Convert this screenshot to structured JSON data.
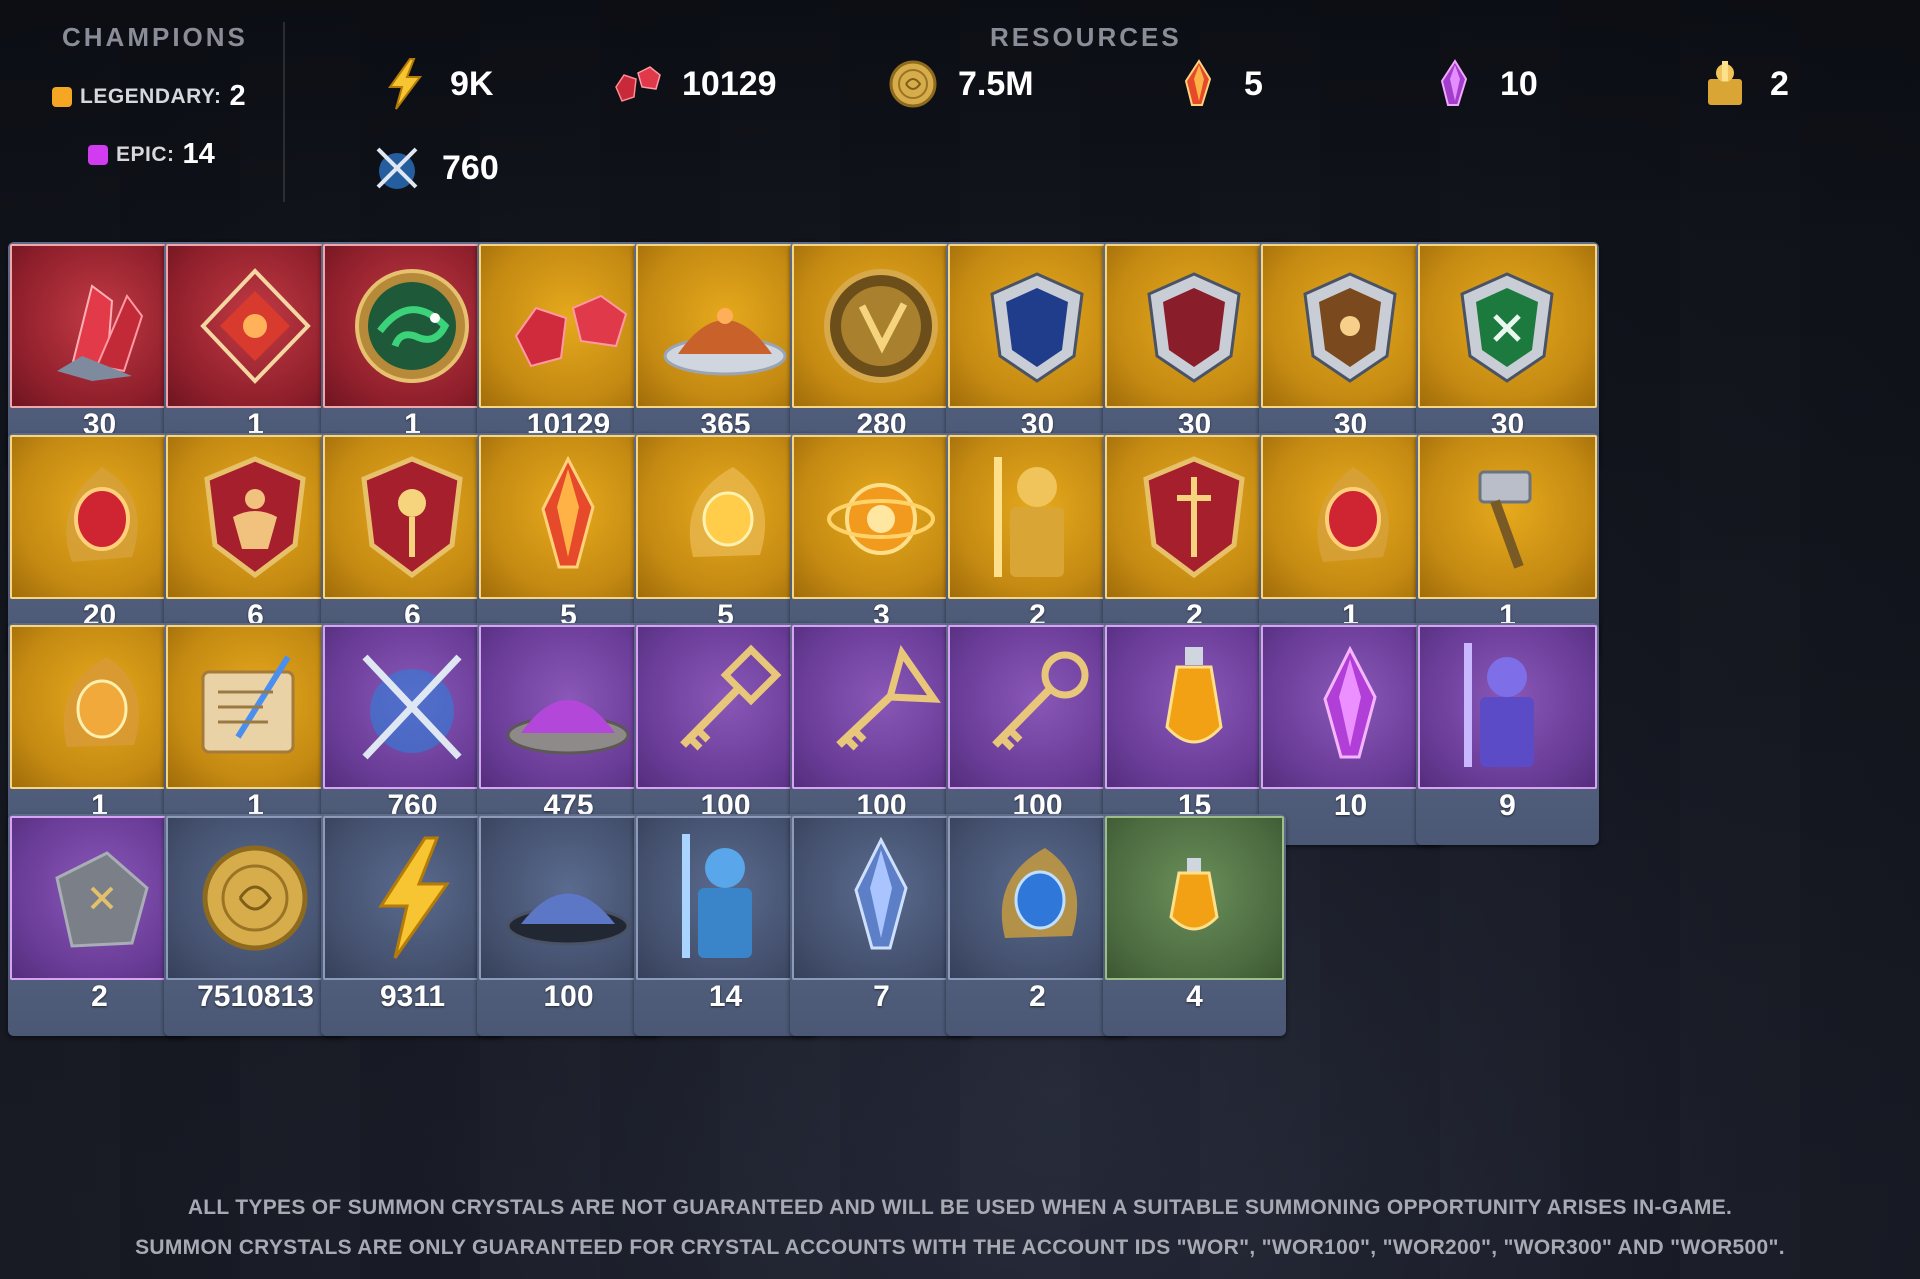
{
  "champions": {
    "title": "CHAMPIONS",
    "legendary": {
      "label": "LEGENDARY:",
      "value": "2",
      "color": "#f5a623"
    },
    "epic": {
      "label": "EPIC:",
      "value": "14",
      "color": "#d23cf0"
    }
  },
  "resources": {
    "title": "RESOURCES",
    "items": [
      {
        "icon": "energy-bolt-icon",
        "value": "9K"
      },
      {
        "icon": "rubies-icon",
        "value": "10129"
      },
      {
        "icon": "silver-coin-icon",
        "value": "7.5M"
      },
      {
        "icon": "sacred-shard-icon",
        "value": "5"
      },
      {
        "icon": "void-shard-icon",
        "value": "10"
      },
      {
        "icon": "gold-champion-icon",
        "value": "2"
      },
      {
        "icon": "arena-swords-icon",
        "value": "760"
      }
    ]
  },
  "inventory": [
    {
      "icon": "red-crystal-shard-icon",
      "rarity": "red",
      "qty": "30"
    },
    {
      "icon": "red-geometric-gem-icon",
      "rarity": "red",
      "qty": "1"
    },
    {
      "icon": "chameleon-medallion-icon",
      "rarity": "red",
      "qty": "1"
    },
    {
      "icon": "rubies-icon",
      "rarity": "gold",
      "qty": "10129"
    },
    {
      "icon": "orange-dust-bowl-icon",
      "rarity": "gold",
      "qty": "365"
    },
    {
      "icon": "gold-token-icon",
      "rarity": "gold",
      "qty": "280"
    },
    {
      "icon": "blue-crest-shield-icon",
      "rarity": "gold",
      "qty": "30"
    },
    {
      "icon": "red-crest-shield-icon",
      "rarity": "gold",
      "qty": "30"
    },
    {
      "icon": "bronze-crest-shield-icon",
      "rarity": "gold",
      "qty": "30"
    },
    {
      "icon": "green-crest-shield-icon",
      "rarity": "gold",
      "qty": "30"
    },
    {
      "icon": "red-flame-gem-icon",
      "rarity": "gold",
      "qty": "20"
    },
    {
      "icon": "strength-shield-icon",
      "rarity": "gold",
      "qty": "6"
    },
    {
      "icon": "sun-shield-icon",
      "rarity": "gold",
      "qty": "6"
    },
    {
      "icon": "sacred-shard-icon",
      "rarity": "gold",
      "qty": "5"
    },
    {
      "icon": "gold-flame-gem-icon",
      "rarity": "gold",
      "qty": "5"
    },
    {
      "icon": "gold-orb-icon",
      "rarity": "gold",
      "qty": "3"
    },
    {
      "icon": "gold-knight-icon",
      "rarity": "gold",
      "qty": "2"
    },
    {
      "icon": "sword-shield-icon",
      "rarity": "gold",
      "qty": "2"
    },
    {
      "icon": "red-flame-gem-icon",
      "rarity": "gold",
      "qty": "1"
    },
    {
      "icon": "hammer-icon",
      "rarity": "gold",
      "qty": "1"
    },
    {
      "icon": "amber-flame-gem-icon",
      "rarity": "gold",
      "qty": "1"
    },
    {
      "icon": "scroll-quill-icon",
      "rarity": "gold",
      "qty": "1"
    },
    {
      "icon": "arena-swords-icon",
      "rarity": "purple",
      "qty": "760"
    },
    {
      "icon": "purple-dust-bowl-icon",
      "rarity": "purple",
      "qty": "475"
    },
    {
      "icon": "square-key-icon",
      "rarity": "purple",
      "qty": "100"
    },
    {
      "icon": "triangle-key-icon",
      "rarity": "purple",
      "qty": "100"
    },
    {
      "icon": "round-key-icon",
      "rarity": "purple",
      "qty": "100"
    },
    {
      "icon": "orange-potion-icon",
      "rarity": "purple",
      "qty": "15"
    },
    {
      "icon": "void-shard-icon",
      "rarity": "purple",
      "qty": "10"
    },
    {
      "icon": "purple-knight-icon",
      "rarity": "purple",
      "qty": "9"
    },
    {
      "icon": "rune-stone-icon",
      "rarity": "purple",
      "qty": "2"
    },
    {
      "icon": "silver-coin-icon",
      "rarity": "blue",
      "qty": "7510813"
    },
    {
      "icon": "energy-bolt-icon",
      "rarity": "blue",
      "qty": "9311"
    },
    {
      "icon": "blue-dust-bowl-icon",
      "rarity": "blue",
      "qty": "100"
    },
    {
      "icon": "blue-knight-icon",
      "rarity": "blue",
      "qty": "14"
    },
    {
      "icon": "blue-shard-icon",
      "rarity": "blue",
      "qty": "7"
    },
    {
      "icon": "blue-flame-gem-icon",
      "rarity": "blue",
      "qty": "2"
    },
    {
      "icon": "small-orange-potion-icon",
      "rarity": "green",
      "qty": "4"
    }
  ],
  "footer": {
    "line1": "ALL TYPES OF SUMMON CRYSTALS ARE NOT GUARANTEED AND WILL BE USED WHEN A SUITABLE SUMMONING OPPORTUNITY ARISES IN-GAME.",
    "line2": "SUMMON CRYSTALS ARE ONLY GUARANTEED FOR CRYSTAL ACCOUNTS WITH THE ACCOUNT IDS \"WOR\", \"WOR100\", \"WOR200\", \"WOR300\" AND \"WOR500\"."
  },
  "colors": {
    "red_tile": "#8e1f2b",
    "gold_tile": "#c48a12",
    "purple_tile": "#6a3d98",
    "blue_tile": "#434f6c",
    "green_tile": "#4c6b40",
    "card_base": "#4b5875"
  }
}
